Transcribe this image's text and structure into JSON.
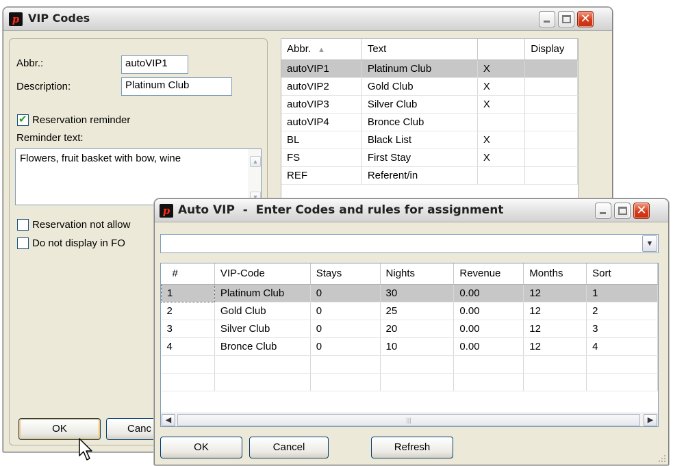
{
  "vip_window": {
    "title": "VIP Codes",
    "abbr_label": "Abbr.:",
    "abbr_value": "autoVIP1",
    "description_label": "Description:",
    "description_value": "Platinum Club",
    "reservation_reminder_label": "Reservation reminder",
    "reservation_reminder_checked": true,
    "reminder_text_label": "Reminder text:",
    "reminder_text_value": "Flowers, fruit basket with bow, wine",
    "reservation_not_allowed_label": "Reservation not allow",
    "do_not_display_label": "Do not display in FO",
    "ok_label": "OK",
    "cancel_label": "Canc",
    "table": {
      "columns": [
        "Abbr.",
        "Text",
        "",
        "Display"
      ],
      "rows": [
        {
          "abbr": "autoVIP1",
          "text": "Platinum Club",
          "flag": "X",
          "display": ""
        },
        {
          "abbr": "autoVIP2",
          "text": "Gold Club",
          "flag": "X",
          "display": ""
        },
        {
          "abbr": "autoVIP3",
          "text": "Silver Club",
          "flag": "X",
          "display": ""
        },
        {
          "abbr": "autoVIP4",
          "text": "Bronce Club",
          "flag": "",
          "display": ""
        },
        {
          "abbr": "BL",
          "text": "Black List",
          "flag": "X",
          "display": ""
        },
        {
          "abbr": "FS",
          "text": "First Stay",
          "flag": "X",
          "display": ""
        },
        {
          "abbr": "REF",
          "text": "Referent/in",
          "flag": "",
          "display": ""
        }
      ]
    }
  },
  "auto_window": {
    "title": "Auto VIP  -  Enter Codes and rules for assignment",
    "combo_value": "",
    "columns": [
      "#",
      "VIP-Code",
      "Stays",
      "Nights",
      "Revenue",
      "Months",
      "Sort"
    ],
    "rows": [
      [
        "1",
        "Platinum Club",
        "0",
        "30",
        "0.00",
        "12",
        "1"
      ],
      [
        "2",
        "Gold Club",
        "0",
        "25",
        "0.00",
        "12",
        "2"
      ],
      [
        "3",
        "Silver Club",
        "0",
        "20",
        "0.00",
        "12",
        "3"
      ],
      [
        "4",
        "Bronce Club",
        "0",
        "10",
        "0.00",
        "12",
        "4"
      ]
    ],
    "ok_label": "OK",
    "cancel_label": "Cancel",
    "refresh_label": "Refresh"
  },
  "icons": {
    "app": "app-logo-icon",
    "minimize": "minimize-icon",
    "maximize": "maximize-icon",
    "close": "close-icon",
    "cursor": "mouse-pointer-icon"
  },
  "colors": {
    "window_bg": "#ece9d8",
    "selected_row": "#c7c7c7",
    "close_button": "#d63b1c",
    "app_logo": "#ff2a14"
  }
}
